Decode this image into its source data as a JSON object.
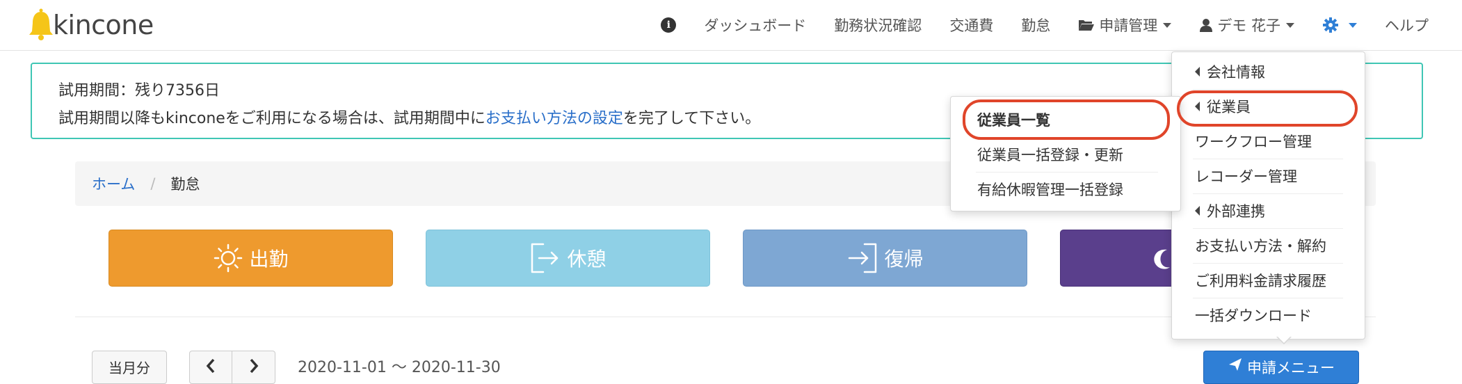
{
  "app": {
    "logo_text": "kincone"
  },
  "nav": {
    "dashboard": "ダッシュボード",
    "work_status": "勤務状況確認",
    "transport": "交通費",
    "attendance": "勤怠",
    "applications": "申請管理",
    "user": "デモ 花子",
    "help": "ヘルプ"
  },
  "trial": {
    "remaining": "試用期間：残り7356日",
    "message_before": "試用期間以降もkinconeをご利用になる場合は、試用期間中に",
    "link": "お支払い方法の設定",
    "message_after": "を完了して下さい。"
  },
  "breadcrumb": {
    "home": "ホーム",
    "separator": "/",
    "current": "勤怠"
  },
  "actions": {
    "shukkin": "出勤",
    "kyukei": "休憩",
    "fukki": "復帰"
  },
  "controls": {
    "month": "当月分",
    "period": "2020-11-01 ～ 2020-11-30",
    "apply_menu": "申請メニュー"
  },
  "settings_menu": {
    "items": [
      {
        "label": "会社情報",
        "submenu": true
      },
      {
        "label": "従業員",
        "submenu": true
      },
      {
        "label": "ワークフロー管理",
        "submenu": false
      },
      {
        "label": "レコーダー管理",
        "submenu": false
      },
      {
        "label": "外部連携",
        "submenu": true
      },
      {
        "label": "お支払い方法・解約",
        "submenu": false
      },
      {
        "label": "ご利用料金請求履歴",
        "submenu": false
      },
      {
        "label": "一括ダウンロード",
        "submenu": false
      }
    ]
  },
  "employee_submenu": {
    "items": [
      {
        "label": "従業員一覧"
      },
      {
        "label": "従業員一括登録・更新"
      },
      {
        "label": "有給休暇管理一括登録"
      }
    ]
  },
  "colors": {
    "accent": "#2f7fd6",
    "trial_border": "#3fc6b4",
    "shukkin": "#ee9a2e",
    "kyukei": "#8fd0e6",
    "fukki": "#7ea7d3",
    "taikin": "#5a3f8c",
    "highlight": "#e0452a"
  }
}
